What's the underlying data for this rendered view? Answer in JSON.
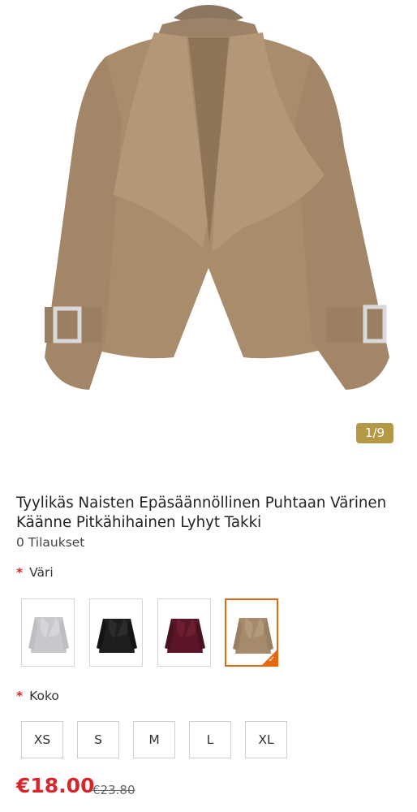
{
  "gallery": {
    "counter": "1/9",
    "image_alt": "jacket-camel"
  },
  "product": {
    "title": "Tyylikäs Naisten Epäsäännöllinen Puhtaan Värinen Käänne Pitkähihainen Lyhyt Takki",
    "orders": "0 Tilaukset"
  },
  "options": {
    "color_label": "Väri",
    "required_mark": "*",
    "colors": [
      {
        "name": "grey",
        "hex": "#c8c8cc"
      },
      {
        "name": "black",
        "hex": "#1e1e1e"
      },
      {
        "name": "burgundy",
        "hex": "#5a1626"
      },
      {
        "name": "camel",
        "hex": "#a58b6b",
        "selected": true
      }
    ],
    "size_label": "Koko",
    "sizes": [
      "XS",
      "S",
      "M",
      "L",
      "XL"
    ]
  },
  "pricing": {
    "price": "€18.00",
    "old_price": "€23.80"
  },
  "theme": {
    "accent": "#d6262a",
    "selected_border": "#e8670e",
    "counter_bg": "#b59846"
  }
}
